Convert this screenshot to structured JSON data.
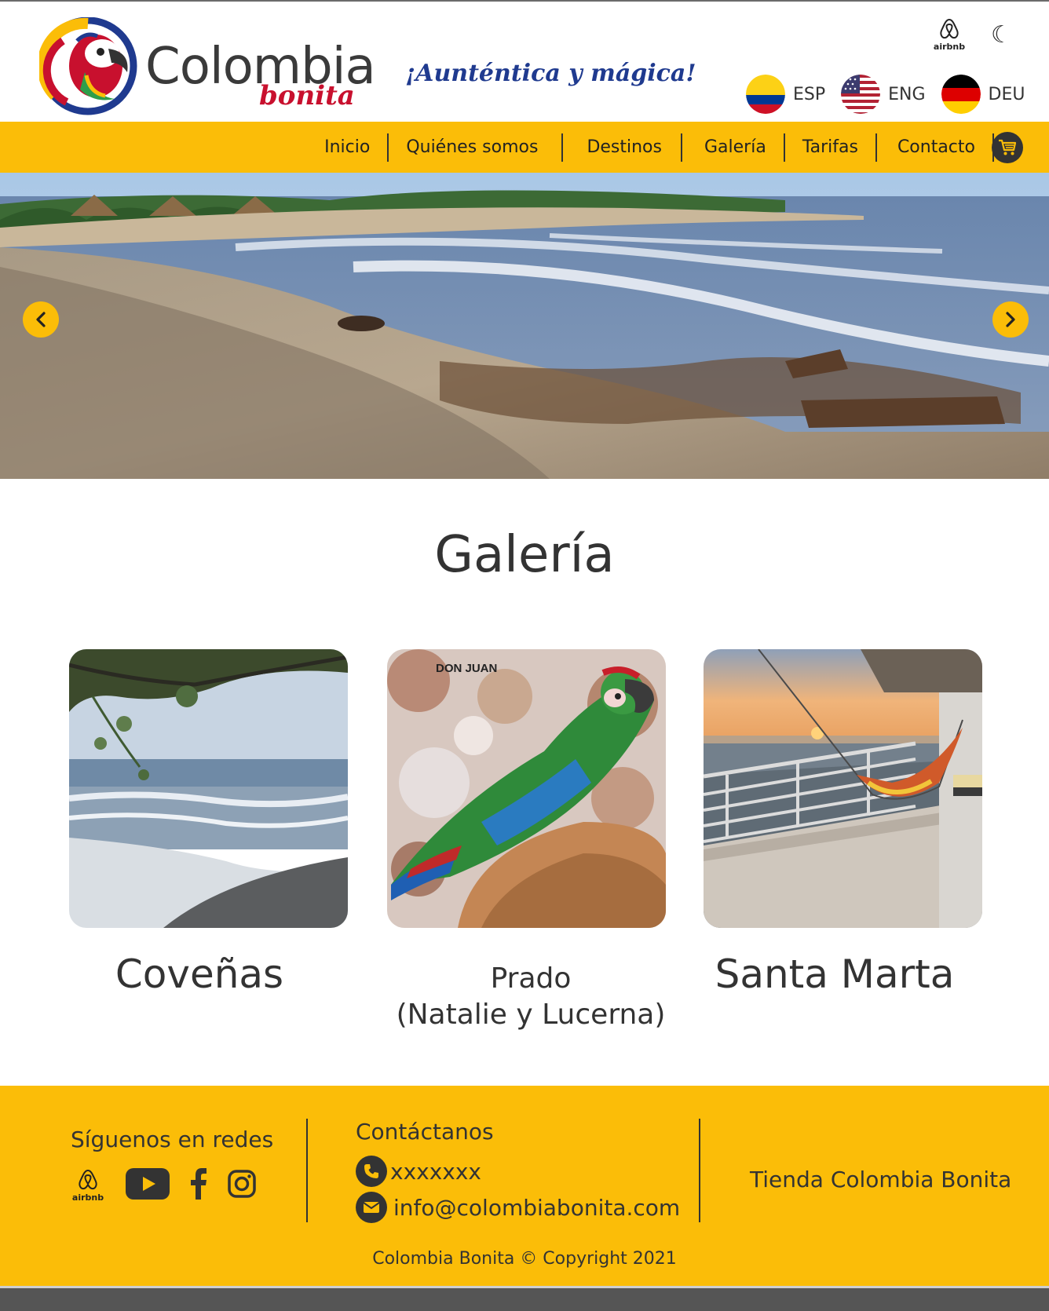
{
  "brand": {
    "title": "Colombia",
    "subtitle": "bonita",
    "slogan": "¡Aunténtica y mágica!"
  },
  "header": {
    "airbnb_label": "airbnb",
    "theme_icon": "moon-icon",
    "languages": [
      {
        "code": "ESP",
        "flag": "colombia-flag"
      },
      {
        "code": "ENG",
        "flag": "usa-flag"
      },
      {
        "code": "DEU",
        "flag": "germany-flag"
      }
    ]
  },
  "nav": {
    "items": [
      "Inicio",
      "Quiénes somos",
      "Destinos",
      "Galería",
      "Tarifas",
      "Contacto"
    ],
    "cart_icon": "cart-icon"
  },
  "hero": {
    "prev_icon": "chevron-left-icon",
    "next_icon": "chevron-right-icon"
  },
  "gallery": {
    "title": "Galería",
    "cards": [
      {
        "caption": "Coveñas"
      },
      {
        "caption_line1": "Prado",
        "caption_line2": "(Natalie y Lucerna)",
        "overlay": "DON JUAN"
      },
      {
        "caption": "Santa Marta"
      }
    ]
  },
  "footer": {
    "social_heading": "Síguenos en redes",
    "airbnb_label": "airbnb",
    "contact_heading": "Contáctanos",
    "phone": "xxxxxxx",
    "email": "info@colombiabonita.com",
    "store": "Tienda Colombia Bonita",
    "copyright": "Colombia Bonita © Copyright 2021"
  },
  "colors": {
    "accent": "#fbbd08",
    "text": "#333333",
    "slogan": "#1f3a8f",
    "brand_red": "#c8102e"
  }
}
